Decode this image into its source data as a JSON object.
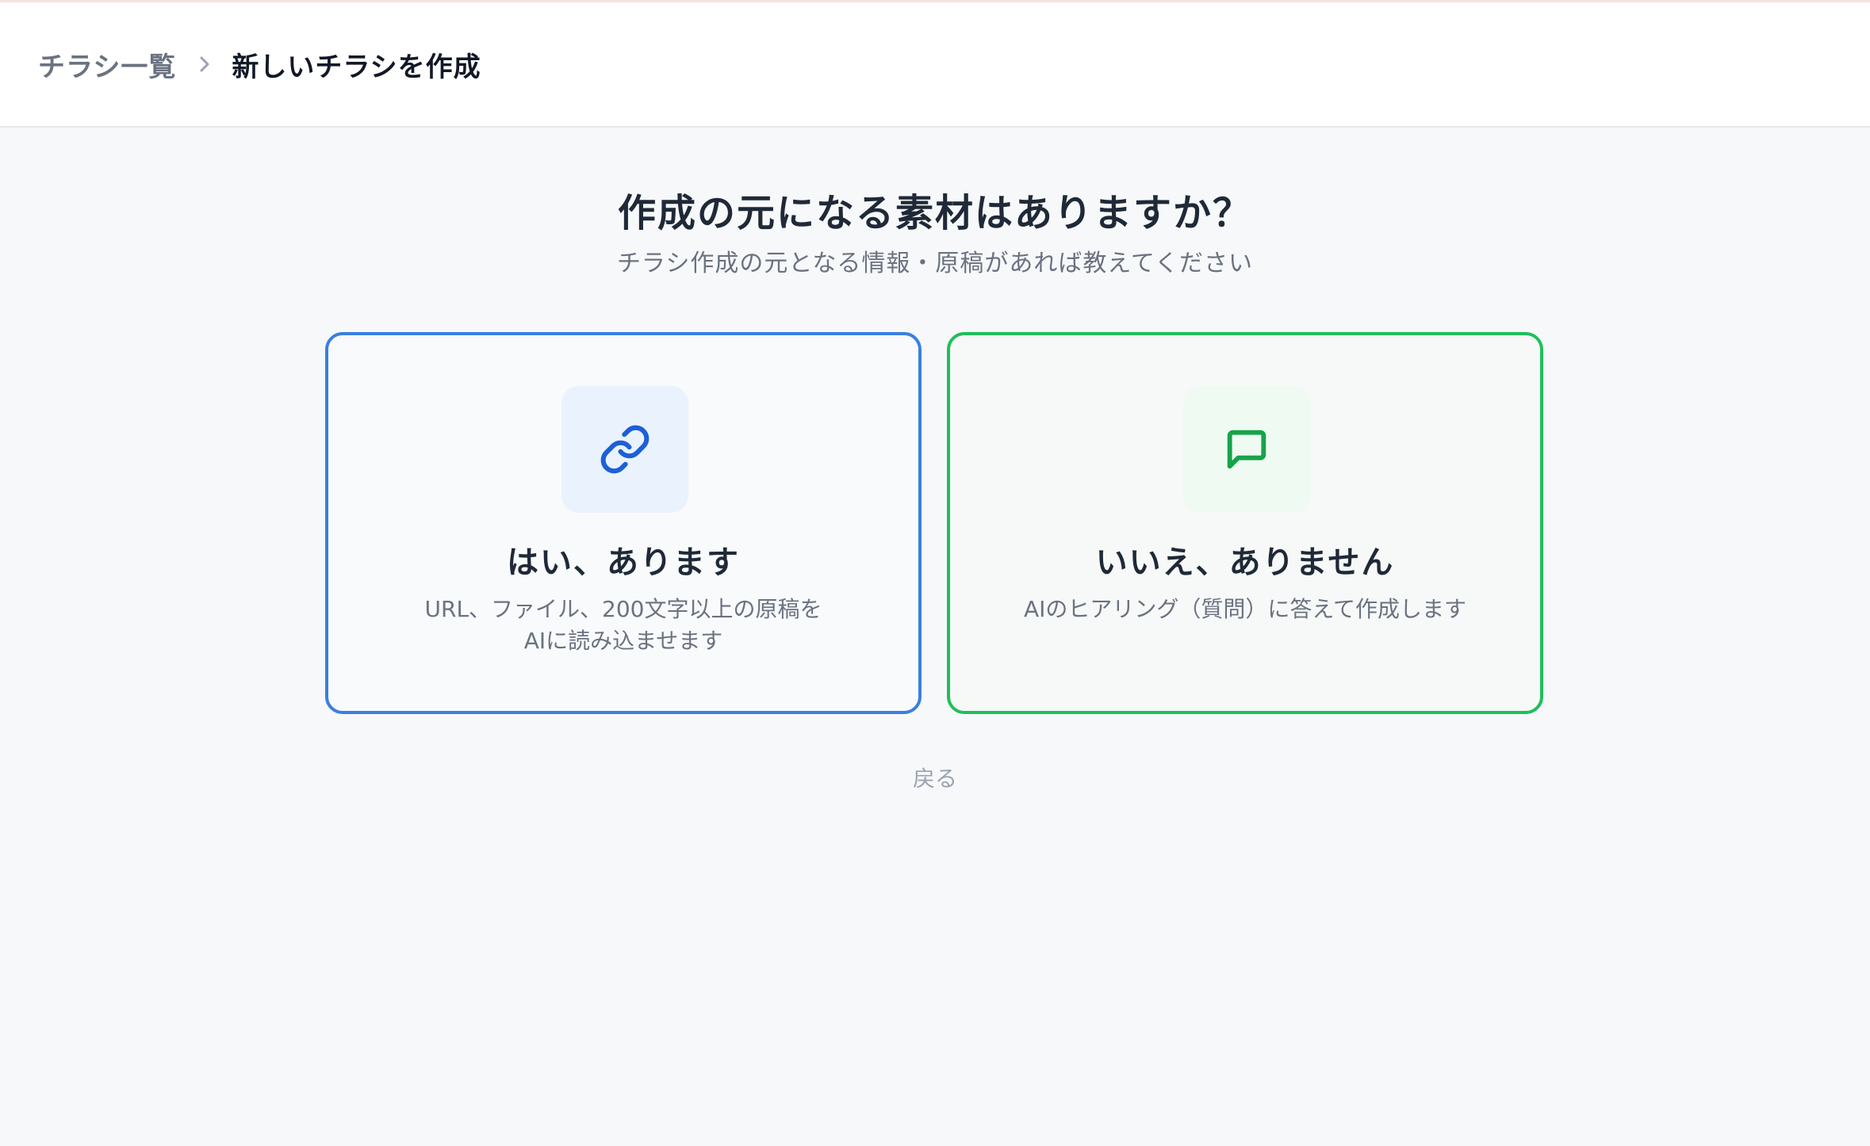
{
  "breadcrumb": {
    "parent": "チラシ一覧",
    "current": "新しいチラシを作成"
  },
  "question": {
    "title": "作成の元になる素材はありますか？",
    "subtitle": "チラシ作成の元となる情報・原稿があれば教えてください"
  },
  "options": {
    "yes": {
      "title": "はい、あります",
      "desc_line1": "URL、ファイル、200文字以上の原稿を",
      "desc_line2": "AIに読み込ませます",
      "icon": "link-icon",
      "color": "#1d5fd6"
    },
    "no": {
      "title": "いいえ、ありません",
      "desc_line1": "AIのヒアリング（質問）に答えて作成します",
      "icon": "chat-bubble-icon",
      "color": "#16a34a"
    }
  },
  "back_label": "戻る"
}
